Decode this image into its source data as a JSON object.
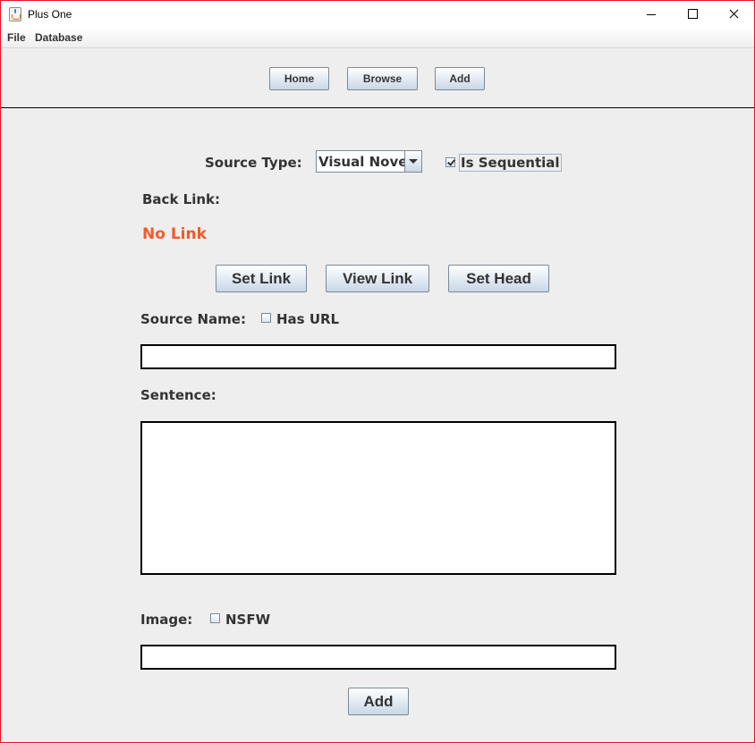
{
  "window": {
    "title": "Plus One"
  },
  "menu": {
    "items": [
      "File",
      "Database"
    ]
  },
  "nav": {
    "home": "Home",
    "browse": "Browse",
    "add": "Add"
  },
  "form": {
    "source_type_label": "Source Type:",
    "source_type_value": "Visual Novel",
    "is_sequential_label": "Is Sequential",
    "is_sequential_checked": true,
    "back_link_label": "Back Link:",
    "link_status": "No Link",
    "link_status_color": "#f05a28",
    "set_link": "Set Link",
    "view_link": "View Link",
    "set_head": "Set Head",
    "source_name_label": "Source Name:",
    "has_url_label": "Has URL",
    "has_url_checked": false,
    "source_name_value": "",
    "sentence_label": "Sentence:",
    "sentence_value": "",
    "image_label": "Image:",
    "nsfw_label": "NSFW",
    "nsfw_checked": false,
    "image_value": "",
    "add_button": "Add"
  },
  "icons": {
    "app": "java-cup-icon",
    "minimize": "minimize-icon",
    "maximize": "maximize-icon",
    "close": "close-icon",
    "dropdown": "chevron-down-icon"
  }
}
